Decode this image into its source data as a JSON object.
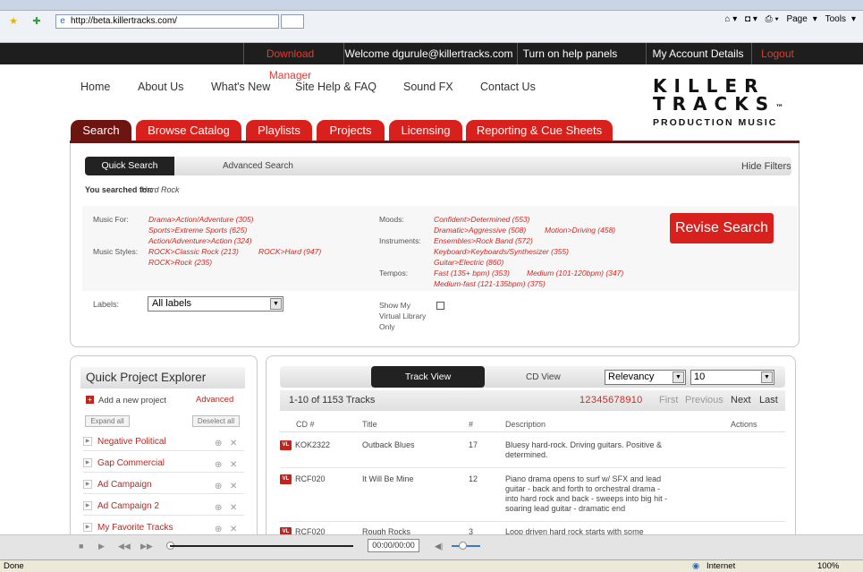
{
  "browser": {
    "url": "http://beta.killertracks.com/",
    "tools": [
      "Page",
      "Tools"
    ],
    "status_left": "Done",
    "zone": "Internet",
    "zoom": "100%"
  },
  "topbar": {
    "download_manager": "Download Manager",
    "welcome": "Welcome dgurule@killertracks.com",
    "help_panels": "Turn on help panels",
    "account": "My Account Details",
    "logout": "Logout"
  },
  "nav": {
    "items": [
      "Home",
      "About Us",
      "What's New",
      "Site Help & FAQ",
      "Sound FX",
      "Contact Us"
    ]
  },
  "logo": {
    "line1": "KILLER",
    "line2": "TRACKS",
    "line3": "PRODUCTION MUSIC",
    "tm": "™"
  },
  "tabs": [
    "Search",
    "Browse Catalog",
    "Playlists",
    "Projects",
    "Licensing",
    "Reporting & Cue Sheets"
  ],
  "search": {
    "quick_search": "Quick Search",
    "advanced_search": "Advanced Search",
    "hide_filters": "Hide Filters",
    "searched_label": "You searched for:",
    "searched_value": "Hard Rock",
    "music_for_label": "Music For:",
    "music_for": [
      "Drama>Action/Adventure (305)",
      "Sports>Extreme Sports (625)",
      "Action/Adventure>Action (324)"
    ],
    "music_styles_label": "Music Styles:",
    "music_styles": [
      "ROCK>Classic Rock (213)",
      "ROCK>Hard (947)",
      "ROCK>Rock (235)"
    ],
    "moods_label": "Moods:",
    "moods": [
      "Confident>Determined (553)",
      "Dramatic>Aggressive (508)",
      "Motion>Driving (458)"
    ],
    "instruments_label": "Instruments:",
    "instruments": [
      "Ensembles>Rock Band (572)",
      "Keyboard>Keyboards/Synthesizer (355)",
      "Guitar>Electric (860)"
    ],
    "tempos_label": "Tempos:",
    "tempos": [
      "Fast (135+ bpm) (353)",
      "Medium (101-120bpm) (347)",
      "Medium-fast (121-135bpm) (375)"
    ],
    "revise": "Revise Search",
    "labels_label": "Labels:",
    "labels_value": "All labels",
    "virtual_library": [
      "Show My",
      "Virtual Library",
      "Only"
    ]
  },
  "project_explorer": {
    "title": "Quick Project Explorer",
    "add_new": "Add a new project",
    "advanced": "Advanced",
    "expand_all": "Expand all",
    "deselect_all": "Deselect all",
    "projects": [
      "Negative Political",
      "Gap Commercial",
      "Ad Campaign",
      "Ad Campaign 2",
      "My Favorite Tracks"
    ]
  },
  "tracks": {
    "track_view": "Track View",
    "cd_view": "CD View",
    "sort": "Relevancy",
    "per_page": "10",
    "count": "1-10 of 1153 Tracks",
    "pages": "12345678910",
    "first": "First",
    "previous": "Previous",
    "next": "Next",
    "last": "Last",
    "headers": [
      "CD #",
      "Title",
      "#",
      "Description",
      "Actions"
    ],
    "rows": [
      {
        "badge": "VL",
        "cd": "KOK2322",
        "title": "Outback Blues",
        "num": "17",
        "desc": [
          "Bluesy hard-rock. Driving guitars. Positive &",
          "determined."
        ]
      },
      {
        "badge": "VL",
        "cd": "RCF020",
        "title": "It Will Be Mine",
        "num": "12",
        "desc": [
          "Piano drama opens to surf w/ SFX and lead",
          "guitar - back and forth to orchestral drama -",
          "into hard rock and back - sweeps into big hit -",
          "soaring lead guitar - dramatic end"
        ]
      },
      {
        "badge": "VL",
        "cd": "RCF020",
        "title": "Rough Rocks",
        "num": "3",
        "desc": [
          "Loop driven hard rock starts with some"
        ]
      }
    ]
  },
  "player": {
    "time": "00:00/00:00"
  }
}
